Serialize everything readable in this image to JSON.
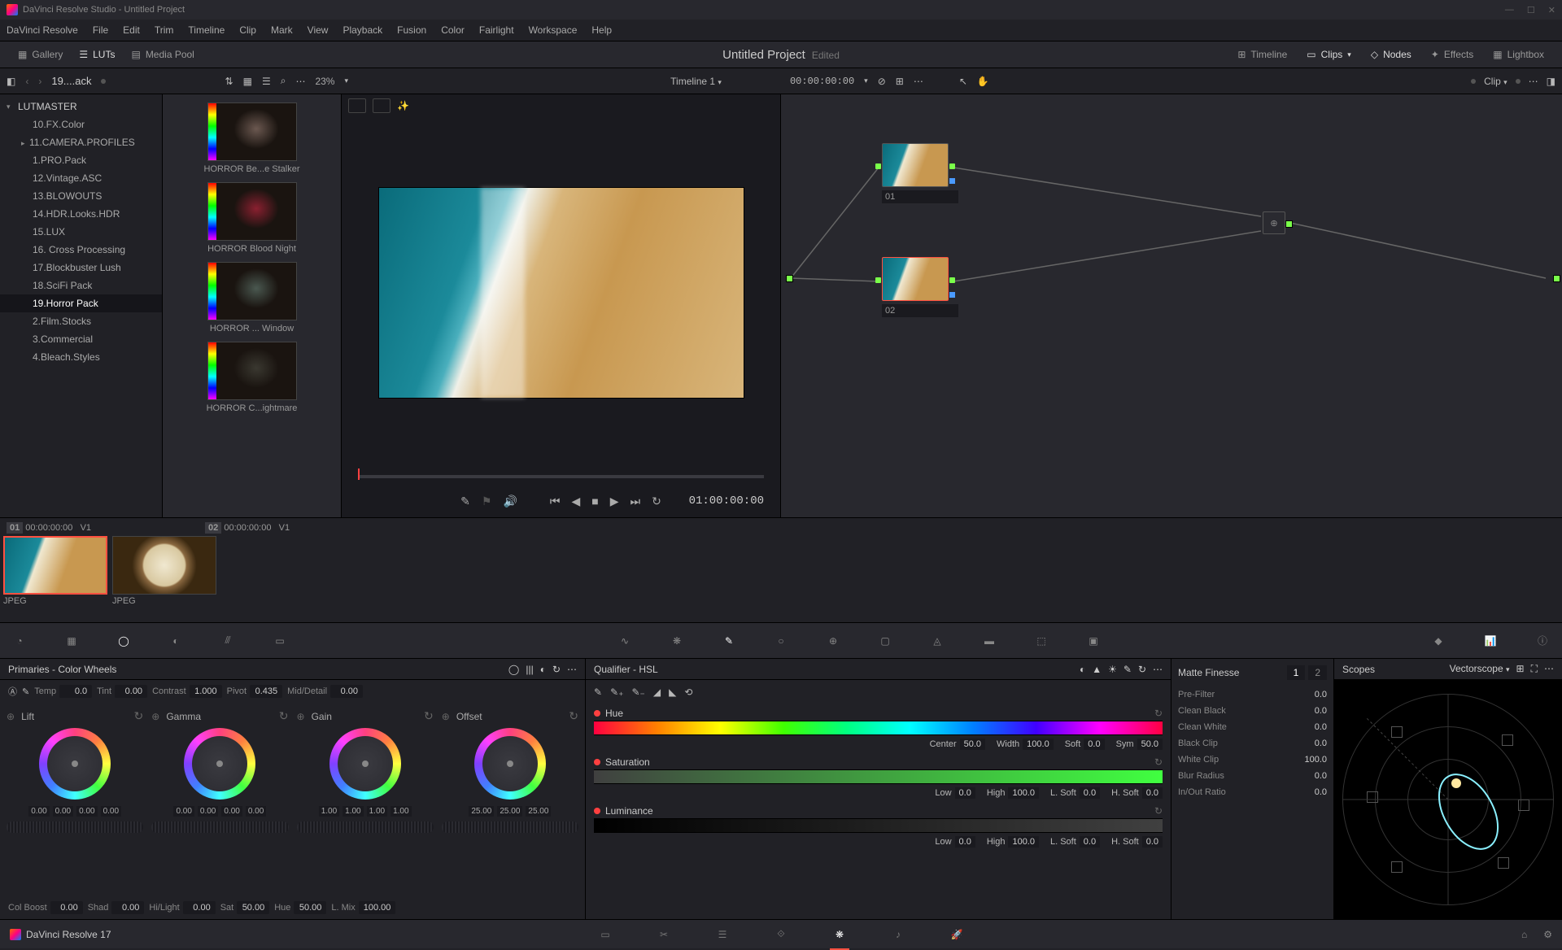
{
  "window": {
    "title": "DaVinci Resolve Studio - Untitled Project"
  },
  "menu": [
    "DaVinci Resolve",
    "File",
    "Edit",
    "Trim",
    "Timeline",
    "Clip",
    "Mark",
    "View",
    "Playback",
    "Fusion",
    "Color",
    "Fairlight",
    "Workspace",
    "Help"
  ],
  "topbar": {
    "gallery": "Gallery",
    "luts": "LUTs",
    "mediapool": "Media Pool",
    "project_title": "Untitled Project",
    "edited": "Edited",
    "timeline": "Timeline",
    "clips": "Clips",
    "nodes": "Nodes",
    "effects": "Effects",
    "lightbox": "Lightbox"
  },
  "secondary": {
    "crumb": "19....ack",
    "zoom": "23%",
    "timeline_name": "Timeline 1",
    "timecode": "00:00:00:00",
    "clip_label": "Clip"
  },
  "tree": {
    "root": "LUTMASTER",
    "items": [
      {
        "label": "10.FX.Color"
      },
      {
        "label": "11.CAMERA.PROFILES",
        "expandable": true
      },
      {
        "label": "1.PRO.Pack"
      },
      {
        "label": "12.Vintage.ASC"
      },
      {
        "label": "13.BLOWOUTS"
      },
      {
        "label": "14.HDR.Looks.HDR"
      },
      {
        "label": "15.LUX"
      },
      {
        "label": "16. Cross Processing"
      },
      {
        "label": "17.Blockbuster Lush"
      },
      {
        "label": "18.SciFi Pack"
      },
      {
        "label": "19.Horror Pack",
        "selected": true
      },
      {
        "label": "2.Film.Stocks"
      },
      {
        "label": "3.Commercial"
      },
      {
        "label": "4.Bleach.Styles"
      }
    ]
  },
  "luts": [
    {
      "name": "HORROR Be...e Stalker",
      "tint": "#6b5850"
    },
    {
      "name": "HORROR Blood Night",
      "tint": "#8a2030"
    },
    {
      "name": "HORROR ... Window",
      "tint": "#4a5850"
    },
    {
      "name": "HORROR C...ightmare",
      "tint": "#3a3830"
    }
  ],
  "viewer": {
    "timecode": "01:00:00:00"
  },
  "nodes": {
    "n1": "01",
    "n2": "02"
  },
  "clips": [
    {
      "idx": "01",
      "tc": "00:00:00:00",
      "track": "V1",
      "format": "JPEG",
      "selected": true,
      "kind": "beach"
    },
    {
      "idx": "02",
      "tc": "00:00:00:00",
      "track": "V1",
      "format": "JPEG",
      "selected": false,
      "kind": "coffee"
    }
  ],
  "primaries": {
    "title": "Primaries - Color Wheels",
    "temp": {
      "label": "Temp",
      "val": "0.0"
    },
    "tint": {
      "label": "Tint",
      "val": "0.00"
    },
    "contrast": {
      "label": "Contrast",
      "val": "1.000"
    },
    "pivot": {
      "label": "Pivot",
      "val": "0.435"
    },
    "middetail": {
      "label": "Mid/Detail",
      "val": "0.00"
    },
    "wheels": {
      "lift": {
        "label": "Lift",
        "vals": [
          "0.00",
          "0.00",
          "0.00",
          "0.00"
        ]
      },
      "gamma": {
        "label": "Gamma",
        "vals": [
          "0.00",
          "0.00",
          "0.00",
          "0.00"
        ]
      },
      "gain": {
        "label": "Gain",
        "vals": [
          "1.00",
          "1.00",
          "1.00",
          "1.00"
        ]
      },
      "offset": {
        "label": "Offset",
        "vals": [
          "25.00",
          "25.00",
          "25.00"
        ]
      }
    },
    "bottom": {
      "colboost": {
        "label": "Col Boost",
        "val": "0.00"
      },
      "shad": {
        "label": "Shad",
        "val": "0.00"
      },
      "hilight": {
        "label": "Hi/Light",
        "val": "0.00"
      },
      "sat": {
        "label": "Sat",
        "val": "50.00"
      },
      "hue": {
        "label": "Hue",
        "val": "50.00"
      },
      "lmix": {
        "label": "L. Mix",
        "val": "100.00"
      }
    }
  },
  "qualifier": {
    "title": "Qualifier - HSL",
    "hue": {
      "label": "Hue",
      "center": {
        "l": "Center",
        "v": "50.0"
      },
      "width": {
        "l": "Width",
        "v": "100.0"
      },
      "soft": {
        "l": "Soft",
        "v": "0.0"
      },
      "sym": {
        "l": "Sym",
        "v": "50.0"
      }
    },
    "sat": {
      "label": "Saturation",
      "low": {
        "l": "Low",
        "v": "0.0"
      },
      "high": {
        "l": "High",
        "v": "100.0"
      },
      "lsoft": {
        "l": "L. Soft",
        "v": "0.0"
      },
      "hsoft": {
        "l": "H. Soft",
        "v": "0.0"
      }
    },
    "lum": {
      "label": "Luminance",
      "low": {
        "l": "Low",
        "v": "0.0"
      },
      "high": {
        "l": "High",
        "v": "100.0"
      },
      "lsoft": {
        "l": "L. Soft",
        "v": "0.0"
      },
      "hsoft": {
        "l": "H. Soft",
        "v": "0.0"
      }
    }
  },
  "matte": {
    "title": "Matte Finesse",
    "tab1": "1",
    "tab2": "2",
    "rows": [
      {
        "label": "Pre-Filter",
        "val": "0.0"
      },
      {
        "label": "Clean Black",
        "val": "0.0"
      },
      {
        "label": "Clean White",
        "val": "0.0"
      },
      {
        "label": "Black Clip",
        "val": "0.0"
      },
      {
        "label": "White Clip",
        "val": "100.0"
      },
      {
        "label": "Blur Radius",
        "val": "0.0"
      },
      {
        "label": "In/Out Ratio",
        "val": "0.0"
      }
    ]
  },
  "scopes": {
    "title": "Scopes",
    "type": "Vectorscope"
  },
  "footer": {
    "app": "DaVinci Resolve 17"
  }
}
